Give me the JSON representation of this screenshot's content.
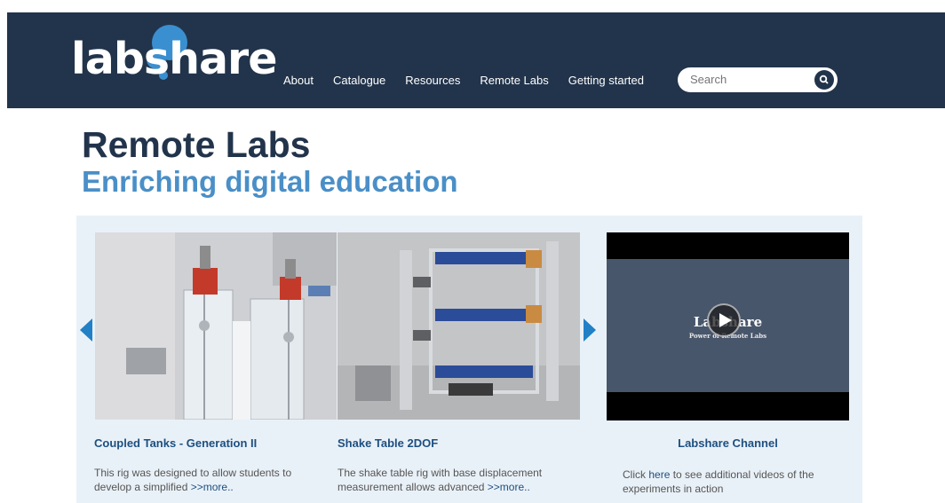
{
  "header": {
    "logo_text": "labshare",
    "nav": [
      "About",
      "Catalogue",
      "Resources",
      "Remote Labs",
      "Getting started"
    ],
    "search_placeholder": "Search"
  },
  "main": {
    "title": "Remote Labs",
    "subtitle": "Enriching digital education"
  },
  "cards": [
    {
      "title": "Coupled Tanks - Generation II",
      "desc_line1": "This rig was designed to allow students to",
      "desc_line2": "develop a simplified ",
      "more": ">>more.."
    },
    {
      "title": "Shake Table 2DOF",
      "desc_line1": "The shake table rig with base displacement",
      "desc_line2": "measurement allows advanced ",
      "more": ">>more.."
    }
  ],
  "video": {
    "title": "Labshare",
    "subtitle": "Power of Remote Labs",
    "channel_title": "Labshare Channel",
    "desc_pre": "Click ",
    "desc_link": "here",
    "desc_post": " to see additional videos of the",
    "desc_line2": "experiments in action"
  },
  "colors": {
    "header_bg": "#22344b",
    "accent_blue": "#4a8fc7",
    "logo_blue": "#3a8fd0",
    "panel_bg": "#e9f1f8",
    "link": "#1d4f80"
  }
}
